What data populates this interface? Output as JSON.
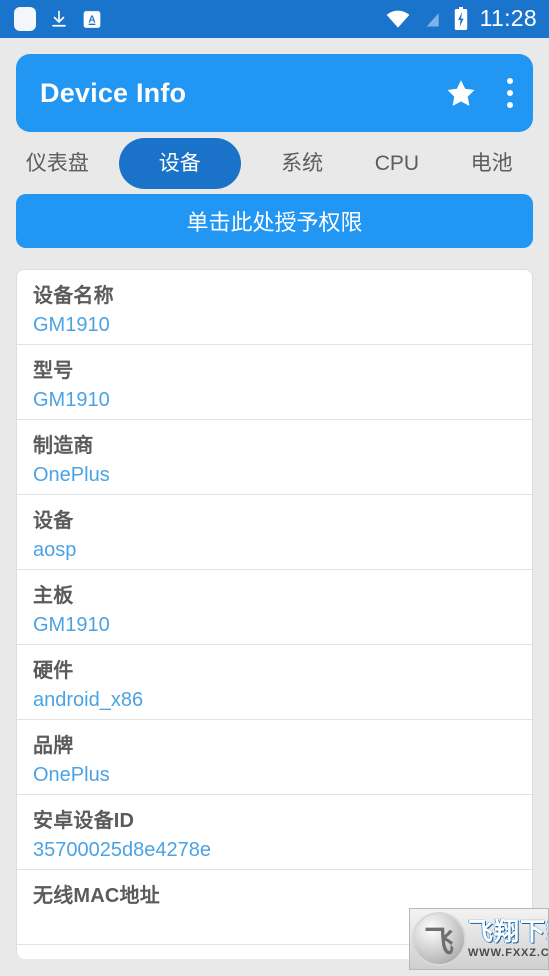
{
  "status_bar": {
    "icons_left": [
      "rounded-square-icon",
      "download-icon",
      "a-badge-icon"
    ],
    "icons_right": [
      "wifi-icon",
      "signal-off-icon",
      "battery-charging-icon"
    ],
    "time": "11:28",
    "background_color": "#1b74cc"
  },
  "appbar": {
    "title": "Device Info",
    "star_icon": "star-icon",
    "overflow_icon": "more-vert-icon",
    "background_color": "#2196f3"
  },
  "tabs": {
    "items": [
      {
        "label": "仪表盘",
        "active": false
      },
      {
        "label": "设备",
        "active": true
      },
      {
        "label": "系统",
        "active": false
      },
      {
        "label": "CPU",
        "active": false
      },
      {
        "label": "电池",
        "active": false
      }
    ],
    "active_color": "#1a73c8"
  },
  "permission_button": {
    "label": "单击此处授予权限",
    "background_color": "#2196f3"
  },
  "device_list": {
    "label_color": "#5b5b5b",
    "value_color": "#4ba3e3",
    "rows": [
      {
        "label": "设备名称",
        "value": "GM1910"
      },
      {
        "label": "型号",
        "value": "GM1910"
      },
      {
        "label": "制造商",
        "value": "OnePlus"
      },
      {
        "label": "设备",
        "value": "aosp"
      },
      {
        "label": "主板",
        "value": "GM1910"
      },
      {
        "label": "硬件",
        "value": "android_x86"
      },
      {
        "label": "品牌",
        "value": "OnePlus"
      },
      {
        "label": "安卓设备ID",
        "value": "35700025d8e4278e"
      },
      {
        "label": "无线MAC地址",
        "value": ""
      }
    ]
  },
  "watermark": {
    "title": "飞翔下载",
    "url": "WWW.FXXZ.COM",
    "logo_glyph": "飞"
  }
}
